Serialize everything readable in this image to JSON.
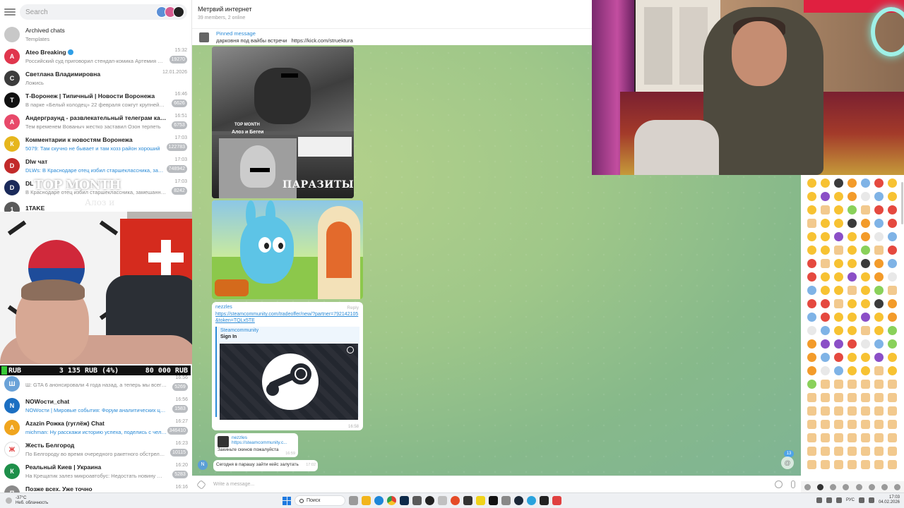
{
  "sidebar": {
    "search_placeholder": "Search",
    "archived": {
      "title": "Archived chats",
      "subtitle": "Templates"
    },
    "chats": [
      {
        "name": "Ateo Breaking",
        "preview": "Российский суд приговорил стендап-комика Артемия Остан...",
        "time": "15:32",
        "badge": "19270",
        "color": "#e0364d",
        "initial": "A"
      },
      {
        "name": "Светлана Владимировна",
        "preview": "Ложись",
        "time": "12.01.2026",
        "badge": "",
        "color": "#3c3c3c",
        "initial": "С"
      },
      {
        "name": "Т-Воронеж | Типичный | Новости Воронежа",
        "preview": "В парке «Белый колодец» 22 февраля сожгут крупнейший ...",
        "time": "16:46",
        "badge": "6626",
        "color": "#111111",
        "initial": "Т"
      },
      {
        "name": "Андерграунд - развлекательный телеграм канал",
        "preview": "Тем временем Вованыч жестко заставил Озон терпеть",
        "time": "16:51",
        "badge": "6753",
        "color": "#e8496a",
        "initial": "А"
      },
      {
        "name": "Комментарии к новостям Воронежа",
        "preview": "5079: Там скучно не бывает и там хозз район хороший",
        "time": "17:03",
        "badge": "122783",
        "color": "#e6b61d",
        "initial": "К",
        "blue": true
      },
      {
        "name": "Dlw чат",
        "preview": "DLWs: В Краснодаре отец избил старшеклассника, замешанно...",
        "time": "17:03",
        "badge": "748942",
        "color": "#c22a2a",
        "initial": "D",
        "blue": true
      },
      {
        "name": "DL",
        "preview": "В Краснодаре отец избил старшеклассника, замешанного в по...",
        "time": "17:03",
        "badge": "8242",
        "color": "#1b2a5a",
        "initial": "D"
      },
      {
        "name": "1TAKE",
        "preview": "",
        "time": "",
        "badge": "",
        "color": "#5a5a5a",
        "initial": "1"
      }
    ],
    "chats_bottom": [
      {
        "name": "",
        "preview": "Ш: GTA 6 анонсировали 4 года назад, а теперь мы всего...",
        "time": "16:56",
        "badge": "5269",
        "color": "#6aa2d8",
        "initial": "Ш"
      },
      {
        "name": "NOWости_chat",
        "preview": "NOWости | Мировые события: Форум аналитических ця...",
        "time": "16:56",
        "badge": "1583",
        "color": "#1c6fc2",
        "initial": "N",
        "blue": true
      },
      {
        "name": "Azazin Рожка (гуглёж) Chat",
        "preview": "michman: Ну расскажи историю успеха, поделись с челядью",
        "time": "16:27",
        "badge": "346410",
        "color": "#f0a51e",
        "initial": "A",
        "blue": true
      },
      {
        "name": "Жесть Белгород",
        "preview": "По Белгороду во время очередного ракетного обстрела выл...",
        "time": "16:23",
        "badge": "10115",
        "color": "#ffffff",
        "initial": "Ж"
      },
      {
        "name": "Реальный Киев | Украина",
        "preview": "На Крещатик залез микроавтобус: Недостать новину @novo...",
        "time": "16:20",
        "badge": "5283",
        "color": "#1e8f4a",
        "initial": "К"
      },
      {
        "name": "Позже всех. Уже точно",
        "preview": "Стали известны главные фейки 2020 года",
        "time": "16:16",
        "badge": "1159",
        "color": "#8a8a8a",
        "initial": "П"
      }
    ]
  },
  "overlay": {
    "top_month": "TOP MONTH",
    "aloz": "Алоз и",
    "ticker": {
      "currency": "RUB",
      "middle": "3 135 RUB (4%)",
      "right": "80 000 RUB"
    }
  },
  "chat": {
    "title": "Метрвий интернет",
    "subtitle": "39 members, 2 online",
    "pinned_title": "Pinned message",
    "pinned_text": "дарковня под вайбы встречи",
    "pinned_link": "https://kick.com/struektura",
    "image1_label_top": "TOP MONTH",
    "image1_label_aloz": "Алоз и Бегеи",
    "image1_caption": "ПАРАЗИТЫ",
    "link_msg": {
      "sender": "nezzles",
      "reply": "Reply",
      "url": "https://steamcommunity.com/tradeoffer/new/?partner=792142105&token=TQLx5TE",
      "site": "Steamcommunity",
      "title": "Sign In",
      "meta": "16:58"
    },
    "small_msg": {
      "name": "nezzles",
      "url": "https://steamcommunity.c...",
      "text": "Закиньте скинов пожалуйста",
      "time": "16:59"
    },
    "last_msg": {
      "avatar": "N",
      "text": "Сегодня в парашу зайти кейс залутать",
      "time": "17:02"
    },
    "unread_count": "13",
    "composer_placeholder": "Write a message..."
  },
  "taskbar": {
    "weather_temp": "-37°C",
    "weather_desc": "Неб. облачность",
    "search_label": "Поиск",
    "lang": "РУС",
    "time": "17:03",
    "date": "04.02.2026"
  }
}
